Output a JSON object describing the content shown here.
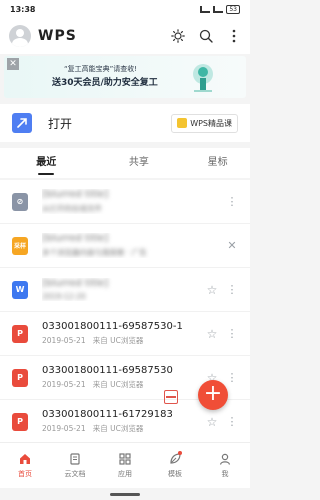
{
  "status": {
    "time": "13:38",
    "battery": "53"
  },
  "header": {
    "logo": "WPS"
  },
  "banner": {
    "line1": "“复工高能宝典”请查收!",
    "line2": "送30天会员/助力安全复工",
    "close_label": "✕"
  },
  "open_row": {
    "label": "打开",
    "premium_label": "WPS精品课"
  },
  "tabs": [
    {
      "label": "最近"
    },
    {
      "label": "共享"
    },
    {
      "label": "星标"
    }
  ],
  "files": [
    {
      "icon": "gray",
      "name": "[blurred title]",
      "meta": "从打开的在线文件",
      "blurred": true,
      "star": false
    },
    {
      "icon": "orange",
      "icon_text": "采样",
      "name": "[blurred title]",
      "meta": "多个浏览器内容与我探索 · 广告",
      "blurred": true,
      "star": false
    },
    {
      "icon": "blue",
      "icon_text": "W",
      "name": "[blurred title]",
      "meta": "2019-12-20",
      "blurred": true,
      "star": true
    },
    {
      "icon": "red",
      "name": "033001800111-69587530-1",
      "date": "2019-05-21",
      "source": "来自 UC浏览器",
      "blurred": false,
      "star": true
    },
    {
      "icon": "red",
      "name": "033001800111-69587530",
      "date": "2019-05-21",
      "source": "来自 UC浏览器",
      "blurred": false,
      "star": true
    },
    {
      "icon": "red",
      "name": "033001800111-61729183",
      "date": "2019-05-21",
      "source": "来自 UC浏览器",
      "blurred": false,
      "star": true
    }
  ],
  "fab": {
    "label": "+"
  },
  "bottom_nav": [
    {
      "label": "首页",
      "active": true
    },
    {
      "label": "云文档",
      "active": false
    },
    {
      "label": "应用",
      "active": false
    },
    {
      "label": "模板",
      "active": false
    },
    {
      "label": "我",
      "active": false
    }
  ],
  "colors": {
    "accent": "#e94b3c",
    "pdf": "#e94b3c",
    "word": "#3d78f0"
  }
}
